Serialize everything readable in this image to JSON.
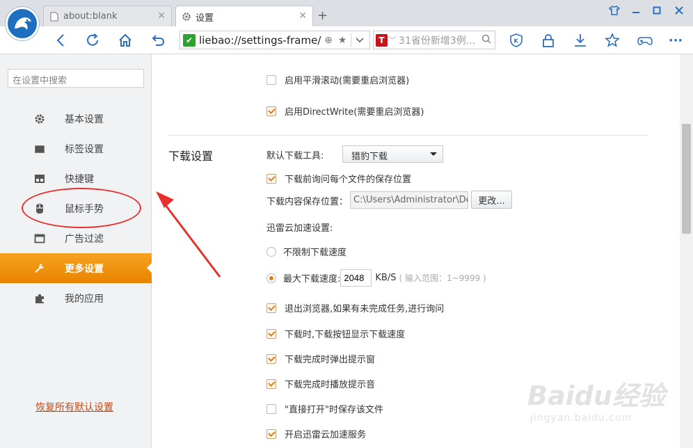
{
  "tabs": [
    {
      "title": "about:blank",
      "active": false
    },
    {
      "title": "设置",
      "active": true
    }
  ],
  "new_tab_symbol": "+",
  "toolbar": {
    "address": "liebao://settings-frame/",
    "search_placeholder": "31省份新增3例...",
    "search_engine_label": "T"
  },
  "sidebar": {
    "search_placeholder": "在设置中搜索",
    "items": [
      {
        "label": "基本设置",
        "icon": "gear-icon"
      },
      {
        "label": "标签设置",
        "icon": "tab-icon"
      },
      {
        "label": "快捷键",
        "icon": "keyboard-icon"
      },
      {
        "label": "鼠标手势",
        "icon": "mouse-icon"
      },
      {
        "label": "广告过滤",
        "icon": "window-icon"
      },
      {
        "label": "更多设置",
        "icon": "wrench-icon",
        "active": true
      },
      {
        "label": "我的应用",
        "icon": "puzzle-icon"
      }
    ],
    "reset_label": "恢复所有默认设置"
  },
  "main": {
    "smooth_scroll": {
      "label": "启用平滑滚动(需要重启浏览器)",
      "checked": false
    },
    "direct_write": {
      "label": "启用DirectWrite(需要重启浏览器)",
      "checked": true
    },
    "download_section_title": "下载设置",
    "default_tool_label": "默认下载工具:",
    "default_tool_value": "猎豹下载",
    "ask_each_file": {
      "label": "下载前询问每个文件的保存位置",
      "checked": true
    },
    "save_location_label": "下载内容保存位置：",
    "save_location_value": "C:\\Users\\Administrator\\Desk",
    "change_button": "更改...",
    "thunder_label": "迅雷云加速设置:",
    "unlimited_speed": {
      "label": "不限制下载速度",
      "selected": false
    },
    "max_speed": {
      "label": "最大下载速度:",
      "selected": true,
      "value": "2048",
      "unit": "KB/S",
      "hint": "( 输入范围：1~9999 )"
    },
    "ask_on_exit": {
      "label": "退出浏览器,如果有未完成任务,进行询问",
      "checked": true
    },
    "show_speed": {
      "label": "下载时,下载按钮显示下载速度",
      "checked": true
    },
    "popup_on_complete": {
      "label": "下载完成时弹出提示窗",
      "checked": true
    },
    "sound_on_complete": {
      "label": "下载完成时播放提示音",
      "checked": true
    },
    "open_direct_save": {
      "label": "\"直接打开\"时保存该文件",
      "checked": false
    },
    "thunder_service": {
      "label": "开启迅雷云加速服务",
      "checked": true
    }
  },
  "watermark": {
    "main": "Baidu经验",
    "sub": "jingyan.baidu.com"
  },
  "colors": {
    "accent": "#f08c0f",
    "annotation": "#e8302f",
    "brand_blue": "#1e6fc0"
  }
}
